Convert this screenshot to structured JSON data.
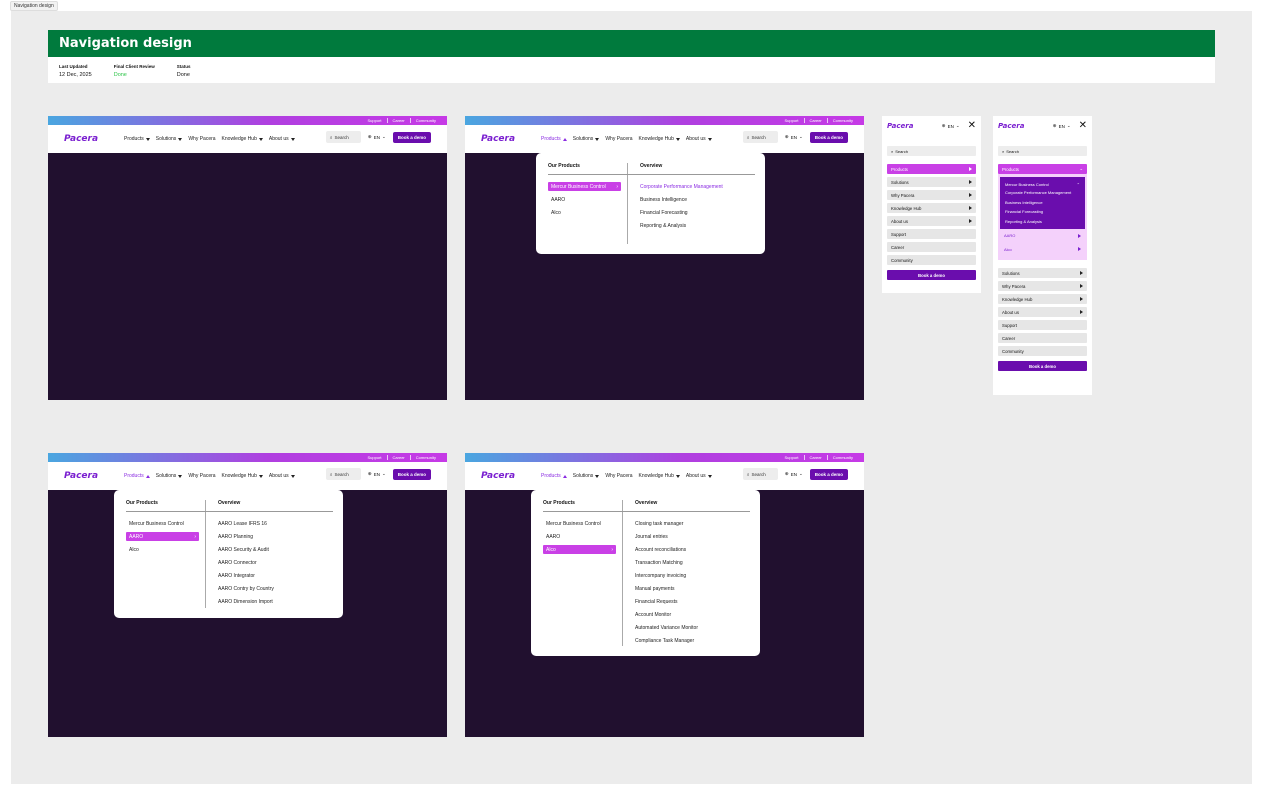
{
  "frame_label": "Navigation design",
  "header": {
    "title": "Navigation design",
    "meta": [
      {
        "key": "Last Updated",
        "value": "12 Dec, 2025"
      },
      {
        "key": "Final Client Review",
        "value": "Done"
      },
      {
        "key": "Status",
        "value": "Done"
      }
    ]
  },
  "site": {
    "logo": "Pacera",
    "top_links": [
      "Support",
      "Career",
      "Community"
    ],
    "nav": [
      "Products",
      "Solutions",
      "Why Pacera",
      "Knowledge Hub",
      "About us"
    ],
    "search": "Search",
    "lang": "EN",
    "cta": "Book a demo"
  },
  "menu": {
    "left_title": "Our Products",
    "right_title": "Overview",
    "products": [
      "Mercur Business Control",
      "AARO",
      "Alco"
    ],
    "mercur_overview": [
      "Corporate Performance Management",
      "Business Intelligence",
      "Financial Forecasting",
      "Reporting & Analysis"
    ],
    "aaro_overview": [
      "AARO Lease IFRS 16",
      "AARO Planning",
      "AARO Security & Audit",
      "AARO Connector",
      "AARO Integrator",
      "AARO Contry by Country",
      "AARO Dimension Import"
    ],
    "alco_overview": [
      "Closing task manager",
      "Journal entries",
      "Account reconciliations",
      "Transaction Matching",
      "Intercompany invoicing",
      "Manual payments",
      "Financial Requests",
      "Account Monitor",
      "Automated Variance Monitor",
      "Compliance Task Manager"
    ]
  },
  "mobile": {
    "items": [
      "Products",
      "Solutions",
      "Why Pacera",
      "Knowledge Hub",
      "About us",
      "Support",
      "Career",
      "Community"
    ],
    "sub_title": "Mercur Business Control",
    "sub_items": [
      "Corporate Performance Management",
      "Business Intelligence",
      "Financial Forecasting",
      "Reporting & Analysis"
    ],
    "other_products": [
      "AARO",
      "Alco"
    ]
  },
  "colors": {
    "banner": "#007a3d",
    "accent": "#c940e6",
    "brand": "#6a0dad",
    "dark_bg": "#21102f"
  }
}
